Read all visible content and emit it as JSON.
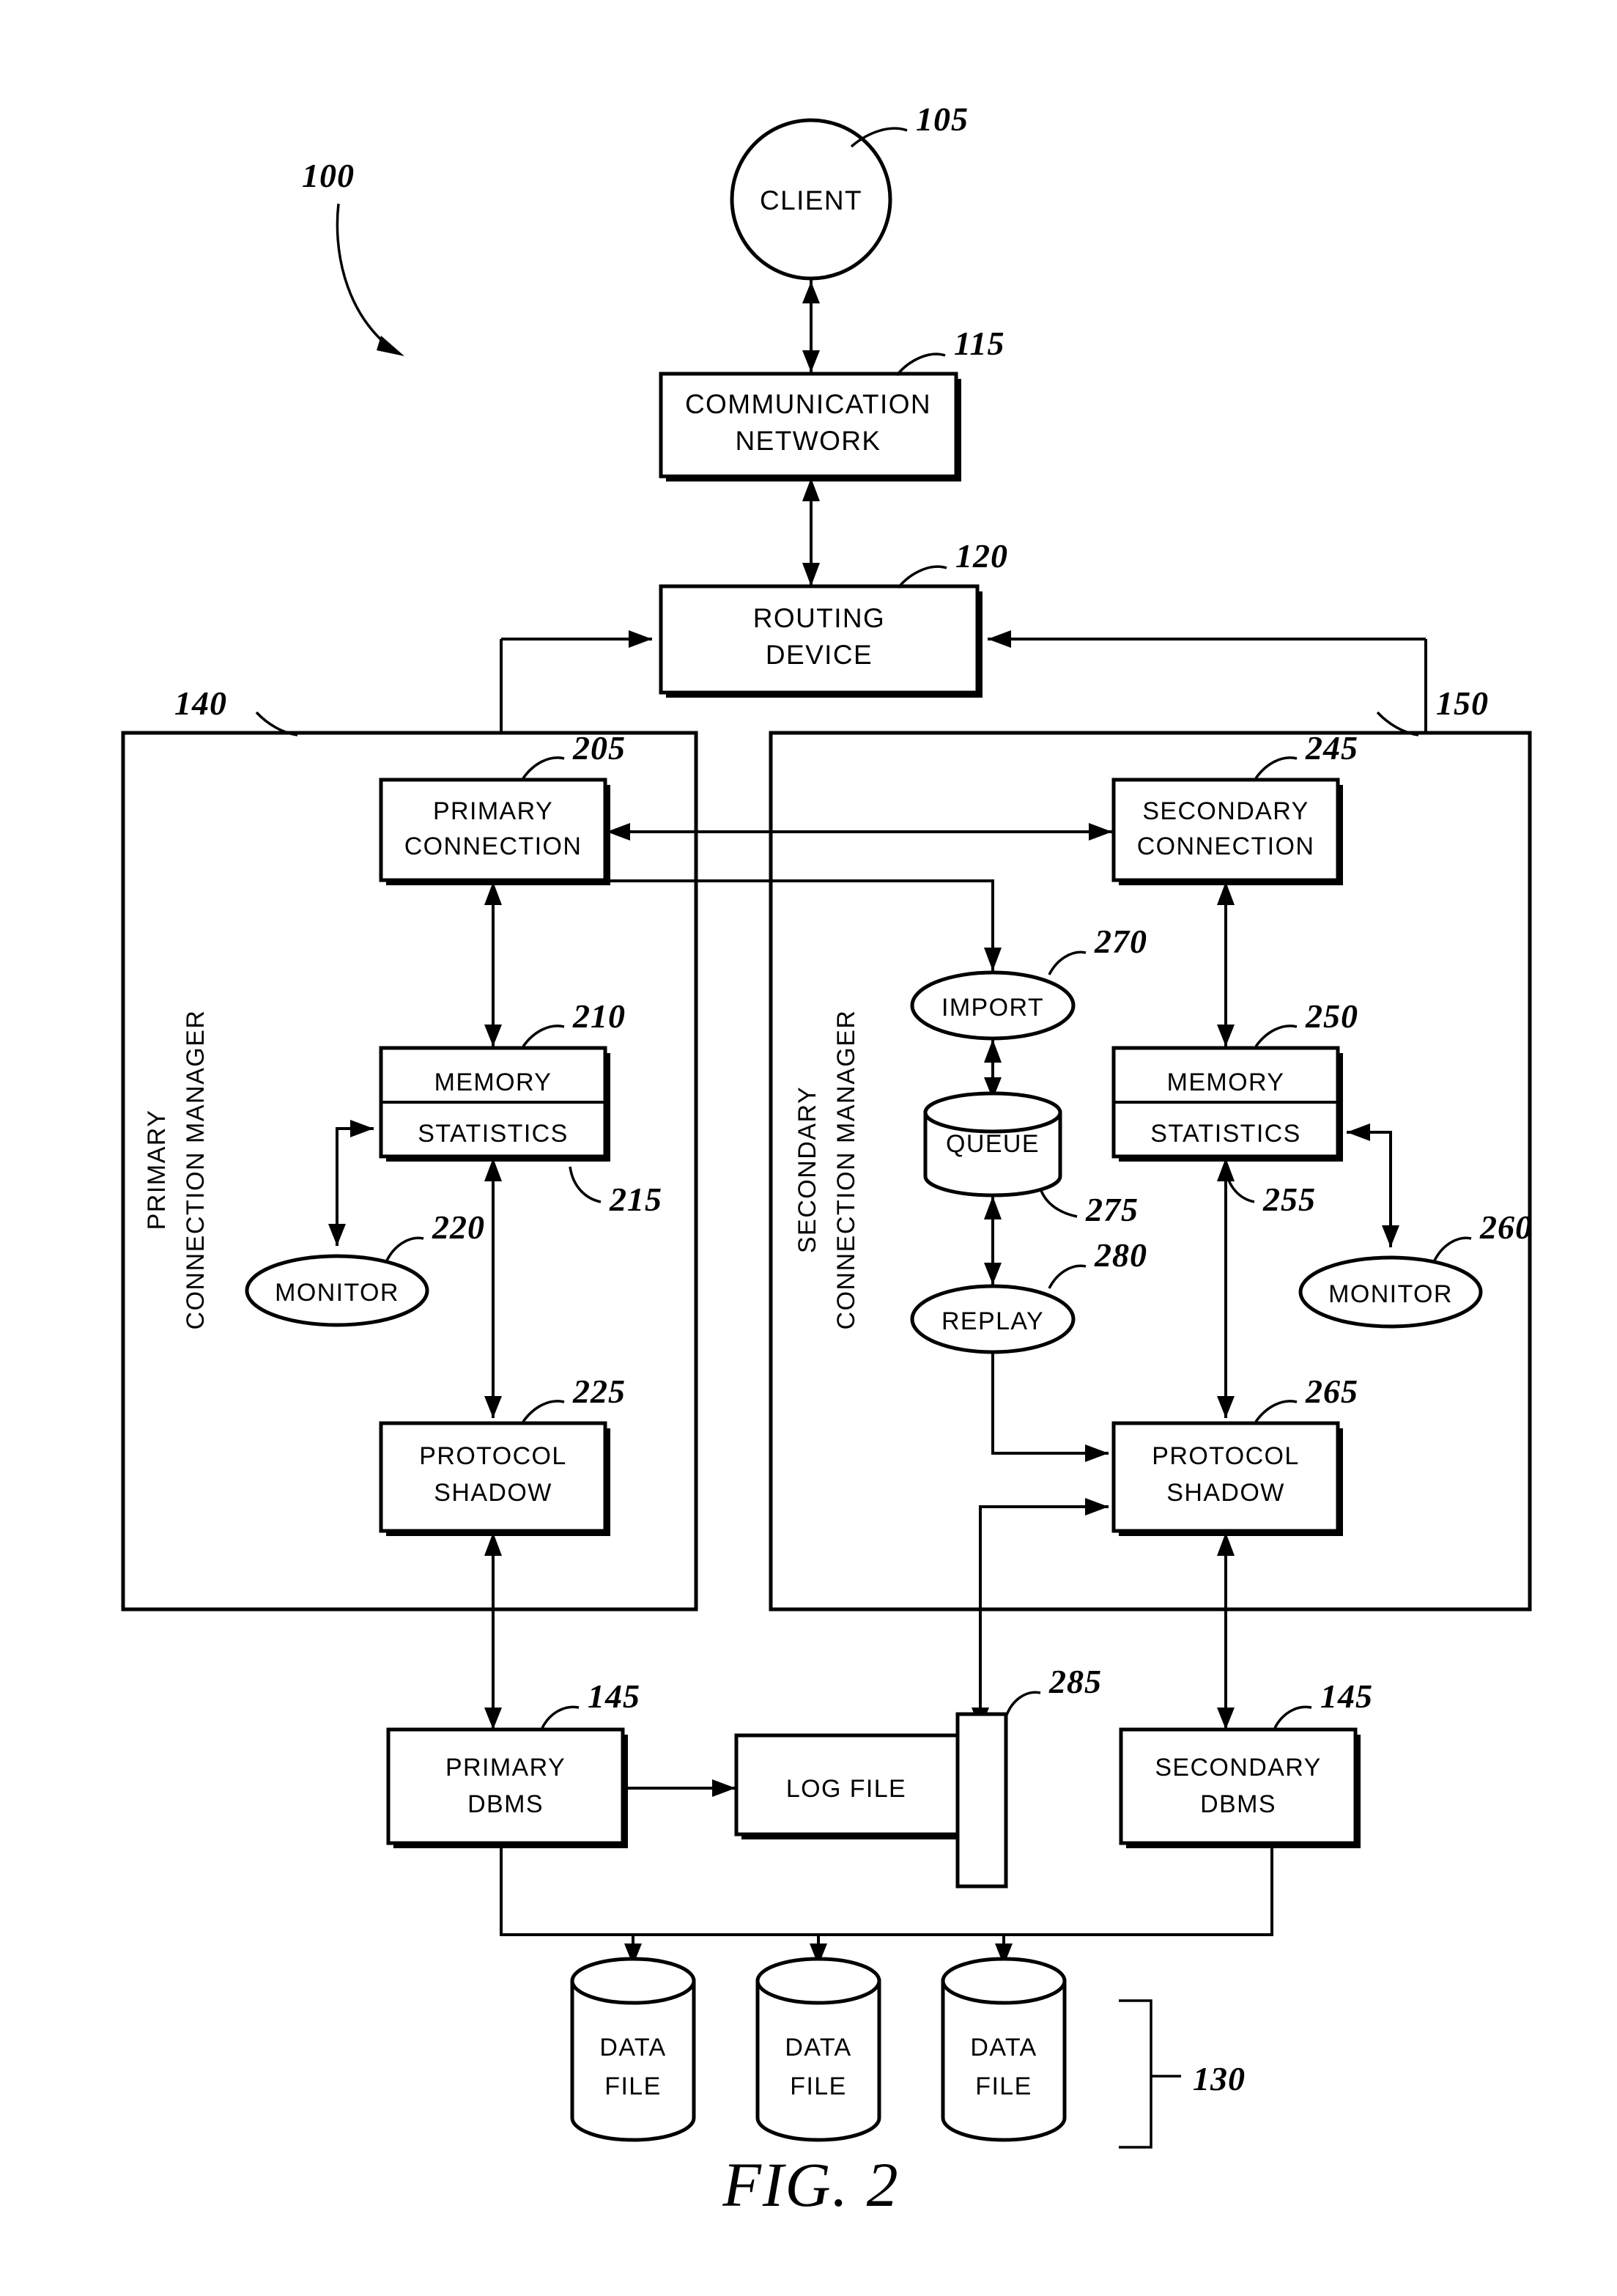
{
  "figure": {
    "title": "FIG. 2",
    "system_ref": "100"
  },
  "nodes": {
    "client": {
      "label": "CLIENT",
      "ref": "105",
      "shape": "circle"
    },
    "comm_network": {
      "line1": "COMMUNICATION",
      "line2": "NETWORK",
      "ref": "115",
      "shape": "box"
    },
    "routing_device": {
      "line1": "ROUTING",
      "line2": "DEVICE",
      "ref": "120",
      "shape": "box"
    },
    "primary_cm": {
      "line1": "PRIMARY",
      "line2": "CONNECTION MANAGER",
      "ref": "140",
      "shape": "frame"
    },
    "secondary_cm": {
      "line1": "SECONDARY",
      "line2": "CONNECTION MANAGER",
      "ref": "150",
      "shape": "frame"
    },
    "primary_conn": {
      "line1": "PRIMARY",
      "line2": "CONNECTION",
      "ref": "205",
      "shape": "box"
    },
    "primary_mem": {
      "line1": "MEMORY",
      "line2": "STATISTICS",
      "ref": "210",
      "ref2": "215",
      "shape": "split-box"
    },
    "primary_monitor": {
      "label": "MONITOR",
      "ref": "220",
      "shape": "ellipse"
    },
    "primary_shadow": {
      "line1": "PROTOCOL",
      "line2": "SHADOW",
      "ref": "225",
      "shape": "box"
    },
    "secondary_conn": {
      "line1": "SECONDARY",
      "line2": "CONNECTION",
      "ref": "245",
      "shape": "box"
    },
    "secondary_mem": {
      "line1": "MEMORY",
      "line2": "STATISTICS",
      "ref": "250",
      "ref2": "255",
      "shape": "split-box"
    },
    "secondary_monitor": {
      "label": "MONITOR",
      "ref": "260",
      "shape": "ellipse"
    },
    "secondary_shadow": {
      "line1": "PROTOCOL",
      "line2": "SHADOW",
      "ref": "265",
      "shape": "box"
    },
    "import": {
      "label": "IMPORT",
      "ref": "270",
      "shape": "ellipse"
    },
    "queue": {
      "label": "QUEUE",
      "ref": "275",
      "shape": "cylinder"
    },
    "replay": {
      "label": "REPLAY",
      "ref": "280",
      "shape": "ellipse"
    },
    "primary_dbms": {
      "line1": "PRIMARY",
      "line2": "DBMS",
      "ref": "145",
      "shape": "box"
    },
    "secondary_dbms": {
      "line1": "SECONDARY",
      "line2": "DBMS",
      "ref": "145",
      "shape": "box"
    },
    "log_file": {
      "label": "LOG  FILE",
      "ref": "285",
      "shape": "box"
    },
    "data_file_1": {
      "line1": "DATA",
      "line2": "FILE",
      "shape": "cylinder"
    },
    "data_file_2": {
      "line1": "DATA",
      "line2": "FILE",
      "shape": "cylinder"
    },
    "data_file_3": {
      "line1": "DATA",
      "line2": "FILE",
      "shape": "cylinder"
    },
    "data_files_group": {
      "ref": "130"
    }
  },
  "colors": {
    "stroke": "#000000",
    "fill": "#ffffff"
  }
}
